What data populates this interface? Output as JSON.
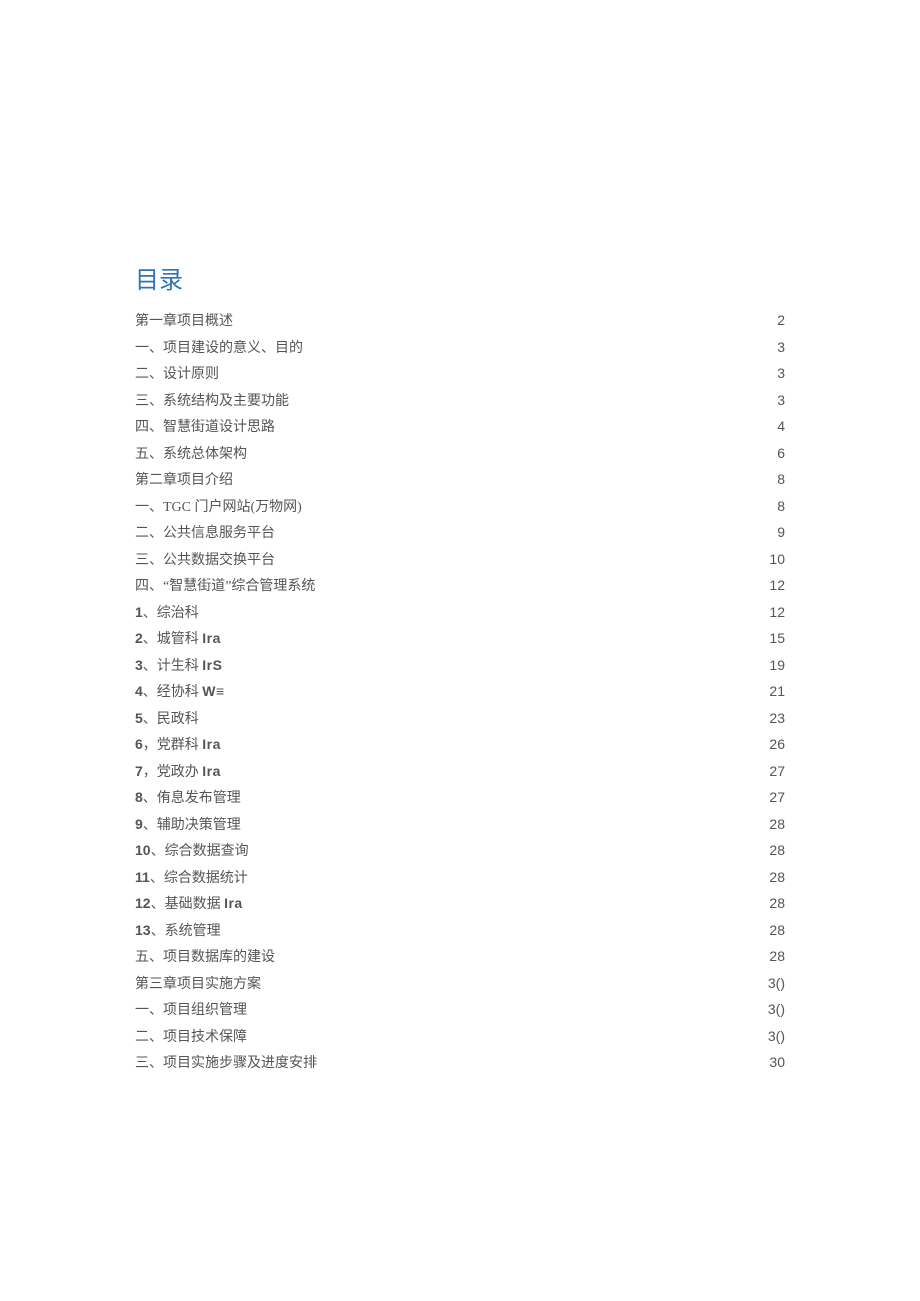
{
  "title": "目录",
  "toc": [
    {
      "label": "第一章项目概述",
      "page": "2",
      "bold": false
    },
    {
      "label": "一、项目建设的意义、目的",
      "page": "3",
      "bold": false
    },
    {
      "label": "二、设计原则",
      "page": "3",
      "bold": false
    },
    {
      "label": "三、系统结构及主要功能",
      "page": "3",
      "bold": false
    },
    {
      "label": "四、智慧街道设计思路",
      "page": "4",
      "bold": false
    },
    {
      "label": "五、系统总体架构",
      "page": "6",
      "bold": false
    },
    {
      "label": "第二章项目介绍",
      "page": "8",
      "bold": false
    },
    {
      "label": "一、TGC 门户网站(万物网)",
      "page": "8",
      "bold": false
    },
    {
      "label": "二、公共信息服务平台",
      "page": "9",
      "bold": false
    },
    {
      "label": "三、公共数据交换平台",
      "page": "10",
      "bold": false
    },
    {
      "label": "四、“智慧街道”综合管理系统",
      "page": "12",
      "bold": false
    },
    {
      "label": "1、综治科",
      "page": "12",
      "bold": false,
      "numPrefix": "1"
    },
    {
      "label": "2、城管科 Ira",
      "page": "15",
      "bold": true,
      "numPrefix": "2",
      "ira": true
    },
    {
      "label": "3、计生科 IrS",
      "page": "19",
      "bold": true,
      "numPrefix": "3",
      "ira": true
    },
    {
      "label": "4、经协科 W≡",
      "page": "21",
      "bold": true,
      "numPrefix": "4",
      "ira": true
    },
    {
      "label": "5、民政科",
      "page": "23",
      "bold": false,
      "numPrefix": "5"
    },
    {
      "label": "6，党群科 Ira",
      "page": "26",
      "bold": true,
      "numPrefix": "6",
      "ira": true
    },
    {
      "label": "7，党政办 Ira",
      "page": "27",
      "bold": true,
      "numPrefix": "7",
      "ira": true
    },
    {
      "label": "8、侑息发布管理",
      "page": "27",
      "bold": false,
      "numPrefix": "8"
    },
    {
      "label": "9、辅助决策管理",
      "page": "28",
      "bold": false,
      "numPrefix": "9"
    },
    {
      "label": "10、综合数据查询",
      "page": "28",
      "bold": false,
      "numPrefix": "10"
    },
    {
      "label": "11、综合数据统计",
      "page": "28",
      "bold": false,
      "numPrefix": "11"
    },
    {
      "label": "12、基础数据 Ira",
      "page": "28",
      "bold": true,
      "numPrefix": "12",
      "ira": true
    },
    {
      "label": "13、系统管理",
      "page": "28",
      "bold": false,
      "numPrefix": "13"
    },
    {
      "label": "五、项目数据库的建设",
      "page": "28",
      "bold": false
    },
    {
      "label": "第三章项目实施方案",
      "page": "3()",
      "bold": false
    },
    {
      "label": "一、项目组织管理",
      "page": "3()",
      "bold": false
    },
    {
      "label": "二、项目技术保障",
      "page": "3()",
      "bold": false
    },
    {
      "label": "三、项目实施步骤及进度安排",
      "page": "30",
      "bold": false
    }
  ]
}
